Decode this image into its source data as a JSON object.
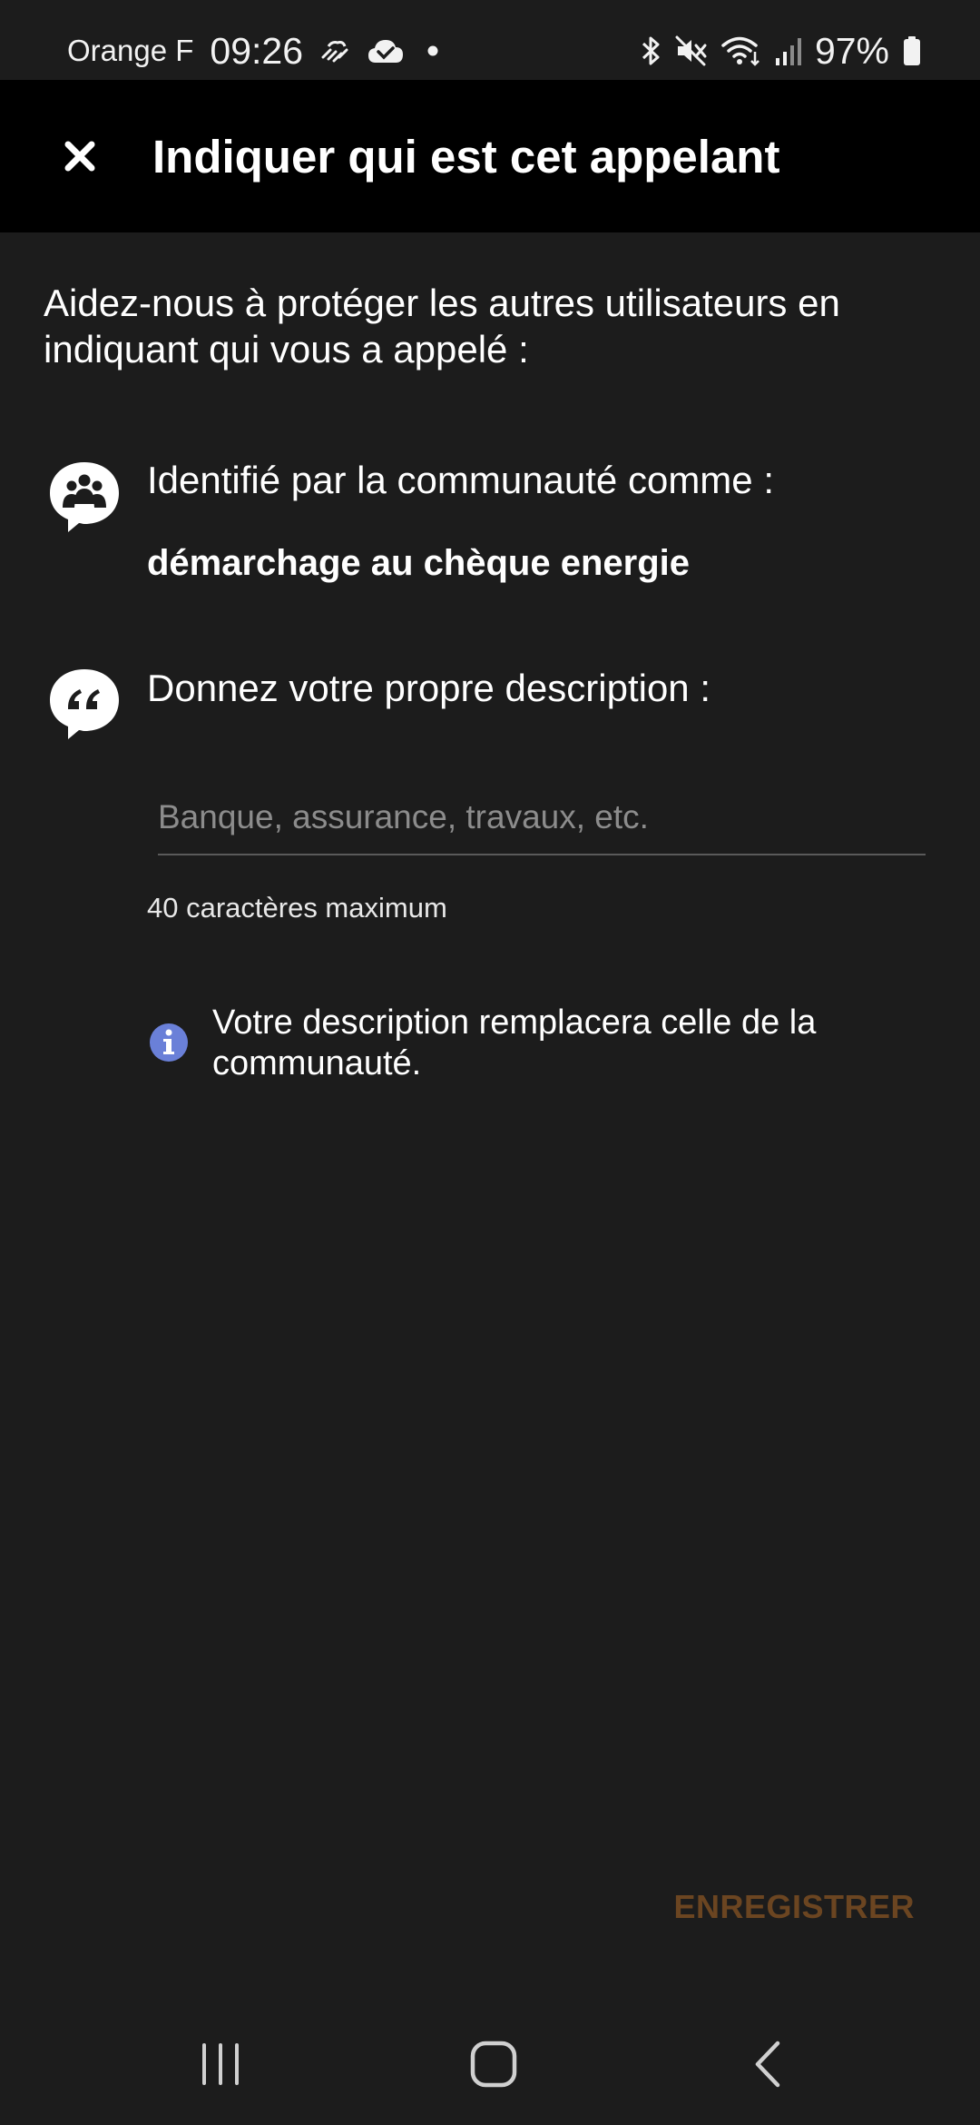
{
  "status_bar": {
    "carrier": "Orange F",
    "time": "09:26",
    "battery": "97%",
    "icons": [
      "weather-icon",
      "cloud-check-icon",
      "dot-icon",
      "bluetooth-icon",
      "mute-icon",
      "wifi-icon",
      "signal-icon",
      "battery-icon"
    ]
  },
  "toolbar": {
    "close_icon": "close-icon",
    "title": "Indiquer qui est cet appelant"
  },
  "main": {
    "intro": "Aidez-nous à protéger les autres utilisateurs en indiquant qui vous a appelé :",
    "community": {
      "icon": "community-icon",
      "label": "Identifié par la communauté comme :",
      "value": "démarchage au chèque energie"
    },
    "own_description": {
      "icon": "quote-icon",
      "label": "Donnez votre propre description :",
      "input_value": "",
      "placeholder": "Banque, assurance, travaux, etc.",
      "hint": "40 caractères maximum"
    },
    "info": {
      "icon": "info-icon",
      "text": "Votre description remplacera celle de la communauté."
    },
    "save_label": "ENREGISTRER"
  },
  "colors": {
    "background": "#1c1c1c",
    "toolbar": "#000000",
    "save_disabled": "#6b4521",
    "info_accent": "#6a80d8"
  },
  "nav_bar": {
    "icons": [
      "recent-apps-icon",
      "home-icon",
      "back-icon"
    ]
  }
}
